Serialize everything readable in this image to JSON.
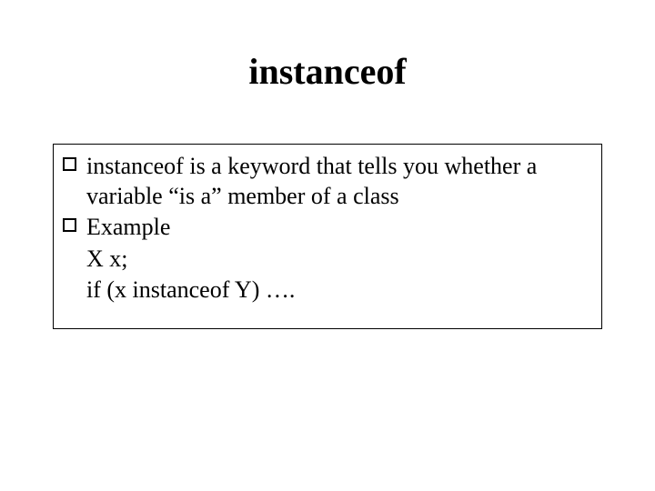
{
  "title": "instanceof",
  "items": [
    {
      "bullet": true,
      "text": "instanceof is a keyword that tells you whether a variable “is a” member of a class"
    },
    {
      "bullet": true,
      "text": "Example"
    },
    {
      "bullet": false,
      "text": "X x;"
    },
    {
      "bullet": false,
      "text": "if (x instanceof Y) …."
    }
  ]
}
